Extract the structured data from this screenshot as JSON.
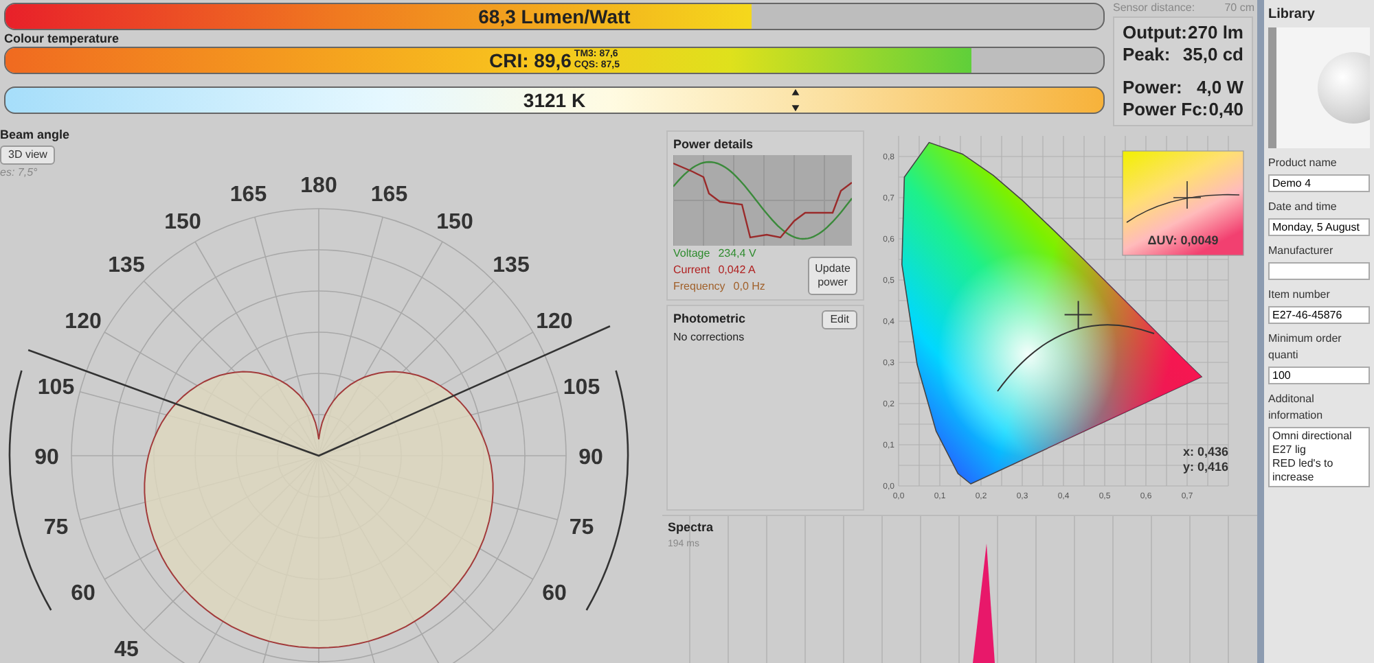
{
  "efficacy_bar": {
    "text": "68,3 Lumen/Watt",
    "level": 0.68
  },
  "cri_bar": {
    "label": "Colour temperature",
    "text": "CRI: 89,6",
    "sub_values": [
      "TM3: 87,6",
      "CQS: 87,5"
    ],
    "level": 0.88
  },
  "cct_bar": {
    "text": "3121 K",
    "level": 0.72
  },
  "sensor_distance": {
    "label": "Sensor distance:",
    "value": "70 cm"
  },
  "stats": [
    [
      {
        "label": "Output:",
        "value": "270 lm"
      },
      {
        "label": "Peak:",
        "value": "35,0 cd"
      }
    ],
    [
      {
        "label": "Power:",
        "value": "4,0 W"
      },
      {
        "label": "Power Fc:",
        "value": "0,40"
      }
    ]
  ],
  "beam_angle": {
    "title": "Beam angle",
    "button": "3D view",
    "resolution": "es: 7,5°",
    "top_label": "180",
    "left_labels": [
      "165",
      "150",
      "135",
      "120",
      "105",
      "90",
      "75",
      "60",
      "45"
    ],
    "right_labels": [
      "165",
      "150",
      "135",
      "120",
      "105",
      "90",
      "75",
      "60"
    ]
  },
  "power_details": {
    "title": "Power details",
    "button": "Update power",
    "readings": [
      {
        "label": "Voltage",
        "value": "234,4 V",
        "color": "#2e8b2e"
      },
      {
        "label": "Current",
        "value": "0,042 A",
        "color": "#b02020"
      },
      {
        "label": "Frequency",
        "value": "0,0 Hz",
        "color": "#a0602a"
      }
    ]
  },
  "photometric": {
    "title": "Photometric",
    "button": "Edit",
    "status": "No corrections"
  },
  "chromaticity": {
    "y_ticks": [
      "0,8",
      "0,7",
      "0,6",
      "0,5",
      "0,4",
      "0,3",
      "0,2",
      "0,1",
      "0,0"
    ],
    "x_ticks": [
      "0,0",
      "0,1",
      "0,2",
      "0,3",
      "0,4",
      "0,5",
      "0,6",
      "0,7"
    ],
    "delta_uv": "ΔUV: 0,0049",
    "x_value": "x: 0,436",
    "y_value": "y: 0,416"
  },
  "spectra": {
    "title": "Spectra",
    "time": "194 ms"
  },
  "library": {
    "title": "Library",
    "fields": [
      {
        "label": "Product name",
        "value": "Demo 4"
      },
      {
        "label": "Date and time",
        "value": "Monday, 5 August"
      },
      {
        "label": "Manufacturer"
      },
      {
        "label": "Item number",
        "value": "E27-46-45876"
      },
      {
        "label": "Minimum order quanti",
        "value": "100"
      }
    ],
    "notes": {
      "label": "Additonal information",
      "lines": [
        "Omni directional E27 lig",
        "RED led's to increase"
      ]
    }
  }
}
